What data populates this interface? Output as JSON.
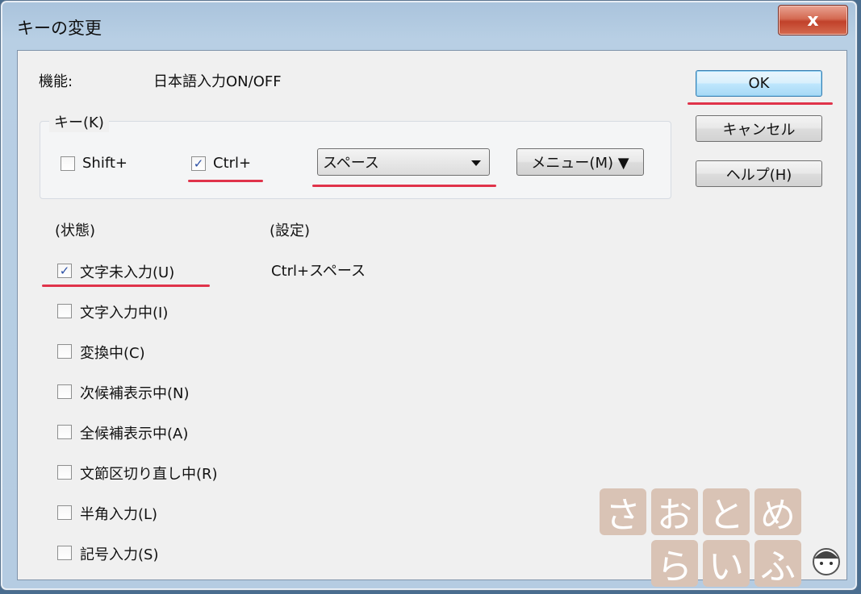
{
  "window": {
    "title": "キーの変更",
    "close_glyph": "x"
  },
  "function": {
    "label": "機能:",
    "value": "日本語入力ON/OFF"
  },
  "key_group": {
    "legend": "キー(K)",
    "shift": {
      "label": "Shift+",
      "checked": false
    },
    "ctrl": {
      "label": "Ctrl+",
      "checked": true
    },
    "key_select_value": "スペース",
    "menu_button": "メニュー(M) ▼"
  },
  "buttons": {
    "ok": "OK",
    "cancel": "キャンセル",
    "help": "ヘルプ(H)"
  },
  "state_header": "(状態)",
  "setting_header": "(設定)",
  "setting_value": "Ctrl+スペース",
  "states": [
    {
      "label": "文字未入力(U)",
      "checked": true
    },
    {
      "label": "文字入力中(I)",
      "checked": false
    },
    {
      "label": "変換中(C)",
      "checked": false
    },
    {
      "label": "次候補表示中(N)",
      "checked": false
    },
    {
      "label": "全候補表示中(A)",
      "checked": false
    },
    {
      "label": "文節区切り直し中(R)",
      "checked": false
    },
    {
      "label": "半角入力(L)",
      "checked": false
    },
    {
      "label": "記号入力(S)",
      "checked": false
    }
  ],
  "watermark": {
    "row1": [
      "さ",
      "お",
      "と",
      "め"
    ],
    "row2": [
      "ら",
      "い",
      "ふ"
    ]
  },
  "check_glyph": "✓",
  "annotation_color": "#e0334a"
}
